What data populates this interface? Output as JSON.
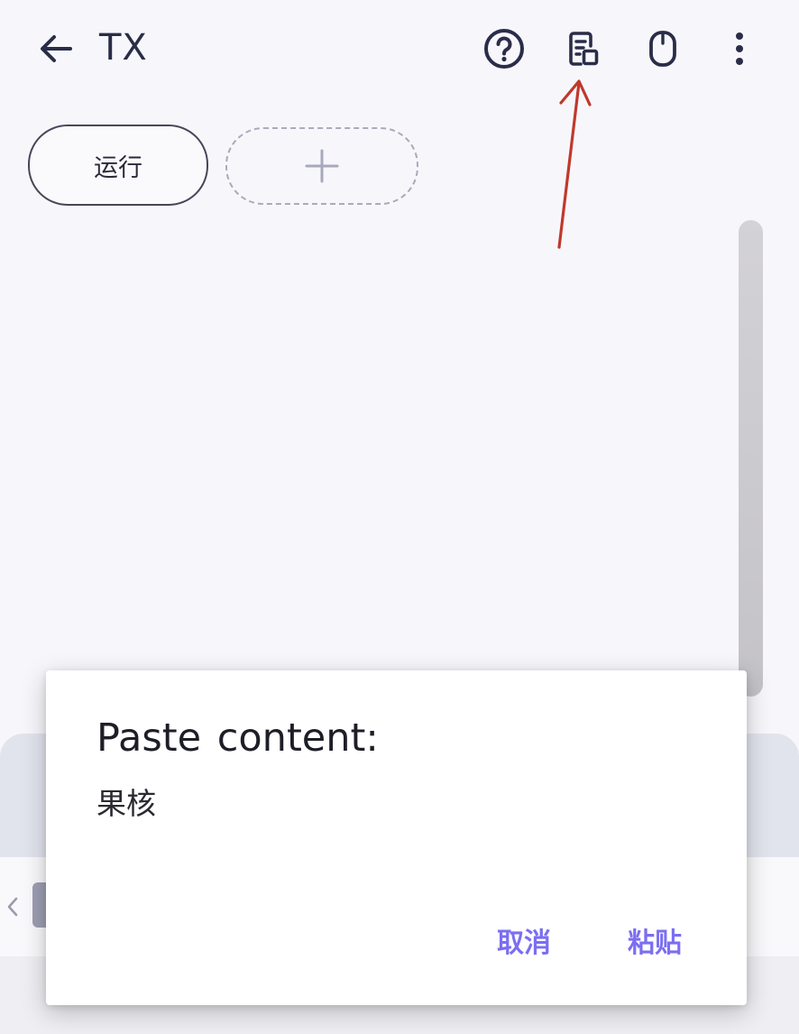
{
  "appbar": {
    "title": "TX",
    "icons": [
      "back-arrow-icon",
      "help-circle-icon",
      "clipboard-icon",
      "mouse-icon",
      "more-vertical-icon"
    ]
  },
  "tabs": {
    "run_label": "运行",
    "add_icon": "plus-icon"
  },
  "dialog": {
    "title": "Paste content:",
    "content": "果核",
    "cancel_label": "取消",
    "paste_label": "粘贴"
  },
  "colors": {
    "background": "#f7f7fb",
    "icon": "#2a2d48",
    "accent": "#7b6ef2",
    "annotation": "#c0392b"
  }
}
